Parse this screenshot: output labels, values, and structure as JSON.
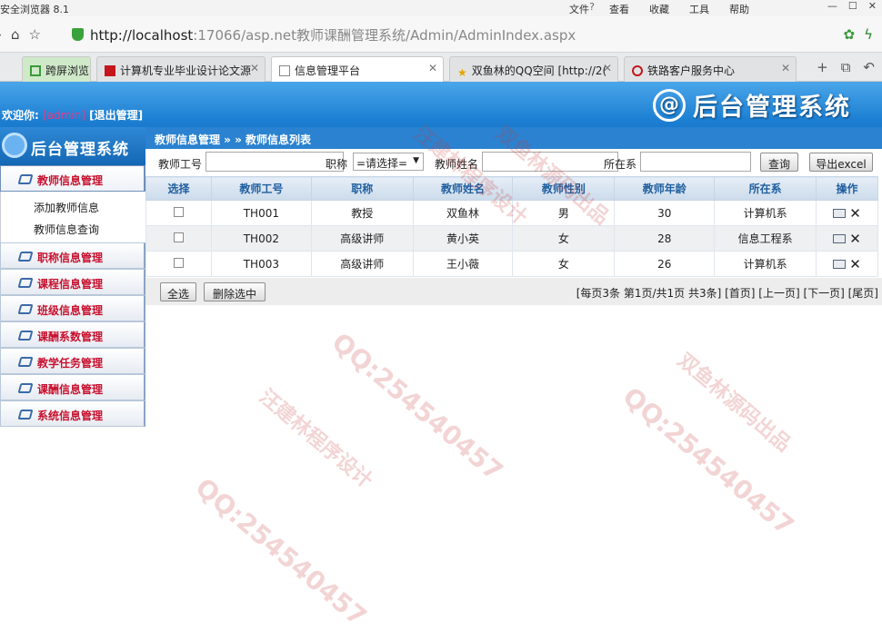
{
  "browser": {
    "app_title": "安全浏览器 8.1",
    "menus": [
      "文件",
      "查看",
      "收藏",
      "工具",
      "帮助"
    ],
    "window_controls": [
      "—",
      "☐",
      "✕"
    ],
    "url_host": "http://localhost",
    "url_path": ":17066/asp.net教师课酬管理系统/Admin/AdminIndex.aspx",
    "tabs": [
      {
        "label": "跨屏浏览"
      },
      {
        "label": "计算机专业毕业设计论文源"
      },
      {
        "label": "信息管理平台"
      },
      {
        "label": "双鱼林的QQ空间 [http://2("
      },
      {
        "label": "铁路客户服务中心"
      }
    ]
  },
  "header": {
    "welcome_label": "欢迎你:",
    "user": "[admin]",
    "logout": "[退出管理]",
    "logo_text": "后台管理系统",
    "logo_symbol": "@"
  },
  "sidebar": {
    "brand": "后台管理系统",
    "menus": [
      {
        "label": "教师信息管理",
        "items": [
          "添加教师信息",
          "教师信息查询"
        ]
      },
      {
        "label": "职称信息管理"
      },
      {
        "label": "课程信息管理"
      },
      {
        "label": "班级信息管理"
      },
      {
        "label": "课酬系数管理"
      },
      {
        "label": "教学任务管理"
      },
      {
        "label": "课酬信息管理"
      },
      {
        "label": "系统信息管理"
      }
    ]
  },
  "breadcrumb": "教师信息管理 » » 教师信息列表",
  "search": {
    "teacher_no_label": "教师工号",
    "title_label": "职称",
    "title_selected": "=请选择=",
    "name_label": "教师姓名",
    "dept_label": "所在系",
    "query_button": "查询",
    "export_button": "导出excel"
  },
  "table": {
    "headers": [
      "选择",
      "教师工号",
      "职称",
      "教师姓名",
      "教师性别",
      "教师年龄",
      "所在系",
      "操作"
    ],
    "rows": [
      {
        "no": "TH001",
        "title": "教授",
        "name": "双鱼林",
        "gender": "男",
        "age": "30",
        "dept": "计算机系"
      },
      {
        "no": "TH002",
        "title": "高级讲师",
        "name": "黄小英",
        "gender": "女",
        "age": "28",
        "dept": "信息工程系"
      },
      {
        "no": "TH003",
        "title": "高级讲师",
        "name": "王小薇",
        "gender": "女",
        "age": "26",
        "dept": "计算机系"
      }
    ]
  },
  "footer": {
    "select_all": "全选",
    "delete_selected": "删除选中",
    "pager": "[每页3条 第1页/共1页 共3条] [首页] [上一页] [下一页] [尾页]"
  },
  "watermarks": [
    "QQ:254540457",
    "汪建林程序设计",
    "双鱼林源码出品"
  ]
}
